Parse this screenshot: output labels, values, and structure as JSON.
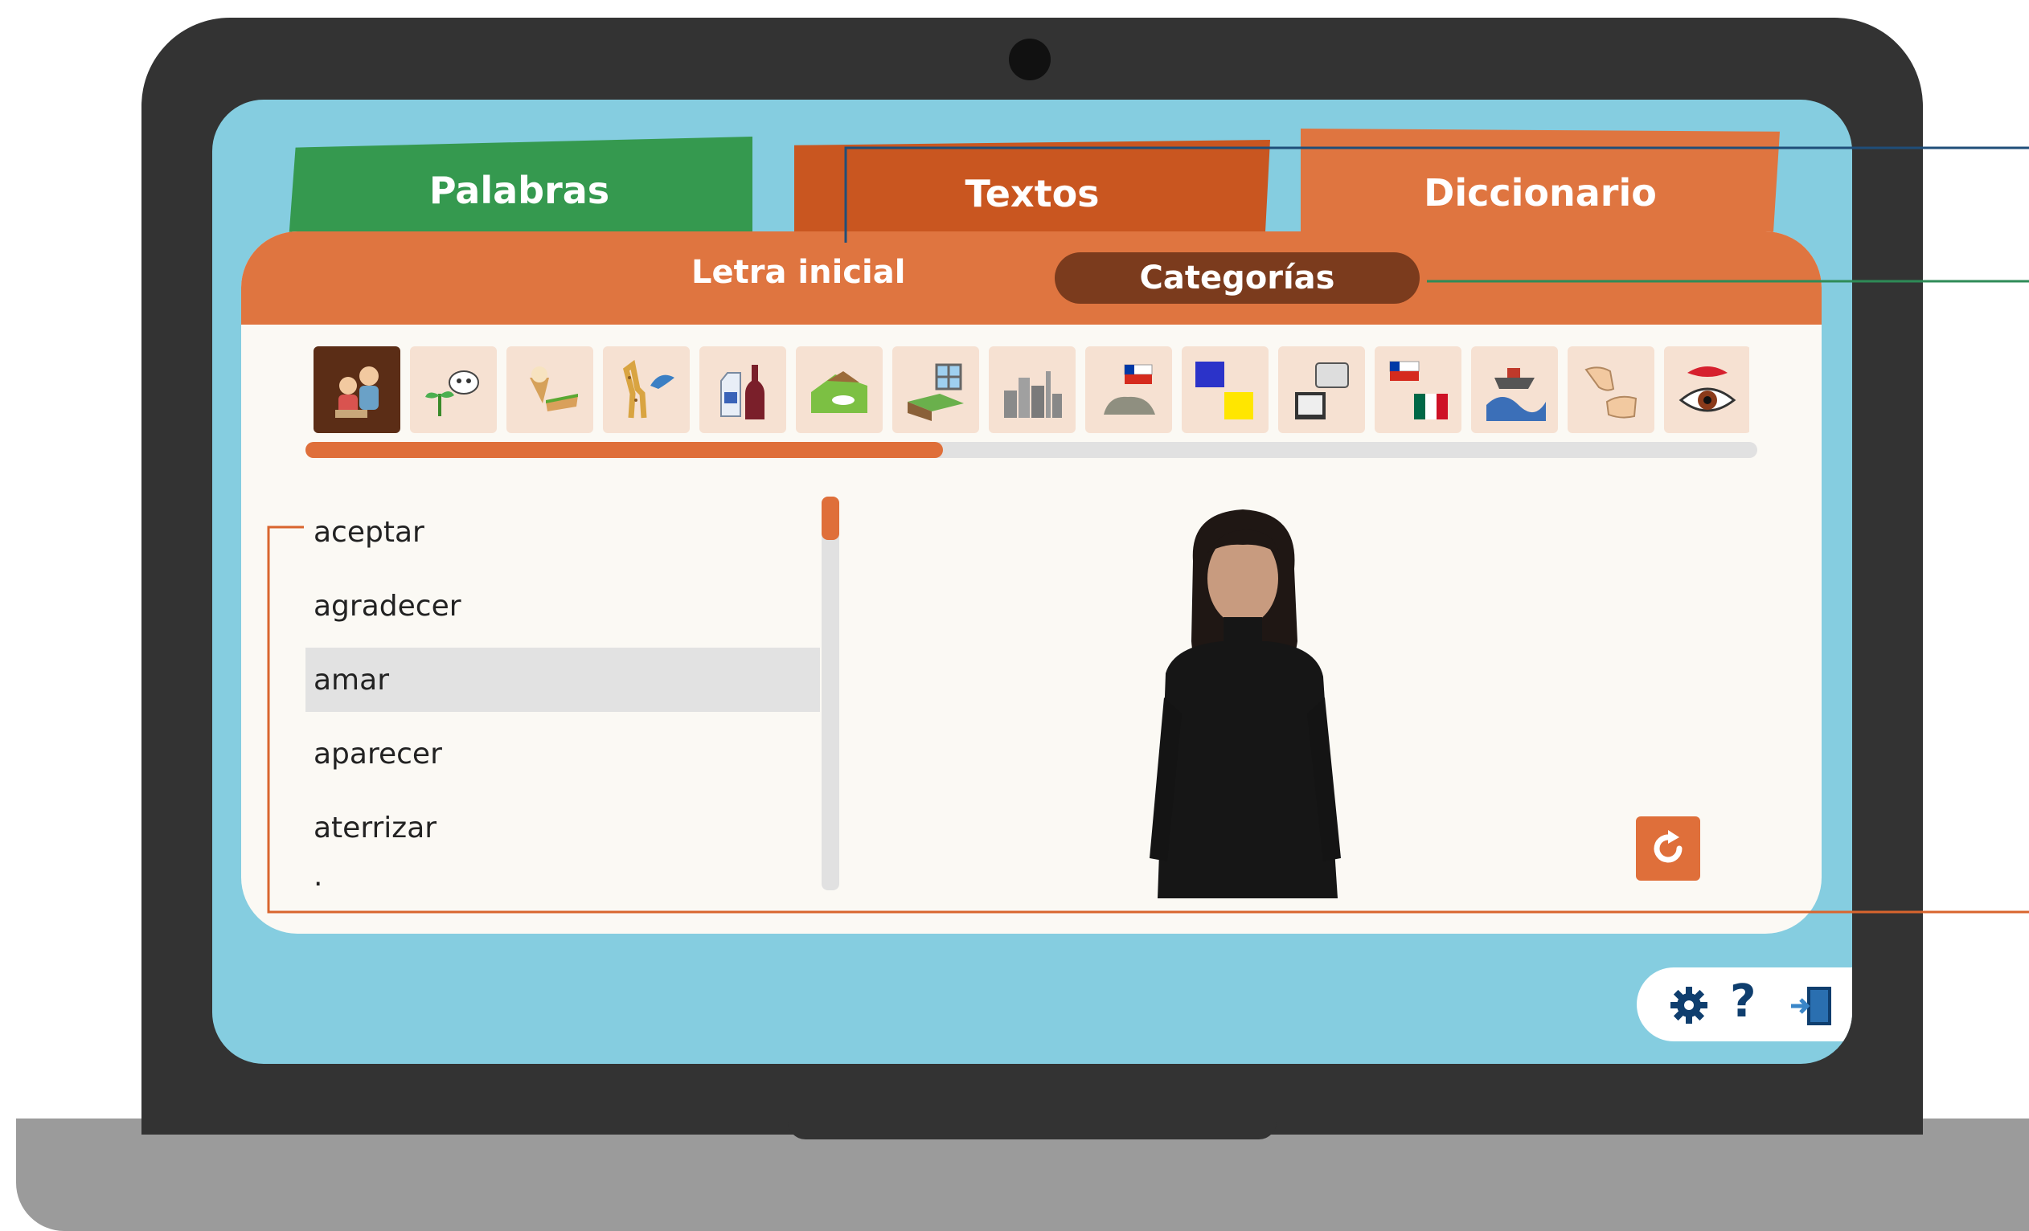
{
  "tabs": {
    "palabras": "Palabras",
    "textos": "Textos",
    "diccionario": "Diccionario"
  },
  "subtabs": {
    "letra_inicial": "Letra inicial",
    "categorias": "Categorías"
  },
  "categories": [
    {
      "icon": "people-communicating-icon",
      "selected": true
    },
    {
      "icon": "cow-plant-icon"
    },
    {
      "icon": "ice-cream-sandwich-icon"
    },
    {
      "icon": "giraffe-bird-icon"
    },
    {
      "icon": "milk-wine-icon"
    },
    {
      "icon": "landscape-icon"
    },
    {
      "icon": "bed-window-icon"
    },
    {
      "icon": "city-icon"
    },
    {
      "icon": "chile-flag-rock-icon"
    },
    {
      "icon": "color-squares-icon"
    },
    {
      "icon": "telephone-tv-icon"
    },
    {
      "icon": "chile-mexico-flags-icon"
    },
    {
      "icon": "ship-wave-icon"
    },
    {
      "icon": "hands-gesture-icon"
    },
    {
      "icon": "eye-lips-icon"
    }
  ],
  "category_scroll_fraction": 0.44,
  "words": [
    {
      "label": "aceptar"
    },
    {
      "label": "agradecer"
    },
    {
      "label": "amar",
      "selected": true
    },
    {
      "label": "aparecer"
    },
    {
      "label": "aterrizar"
    },
    {
      "label": "."
    }
  ],
  "colors": {
    "green_tab": "#35994f",
    "textos_tab": "#c95620",
    "diccionario_tab": "#df7540",
    "selected_subtab": "#7b3b1d",
    "accent": "#df6f3a",
    "screen_bg": "#85cde0",
    "toolbar_icons": "#0f3e6e"
  },
  "toolbar": {
    "icons": [
      "gear-icon",
      "help-icon",
      "exit-door-icon"
    ],
    "help_glyph": "?"
  }
}
